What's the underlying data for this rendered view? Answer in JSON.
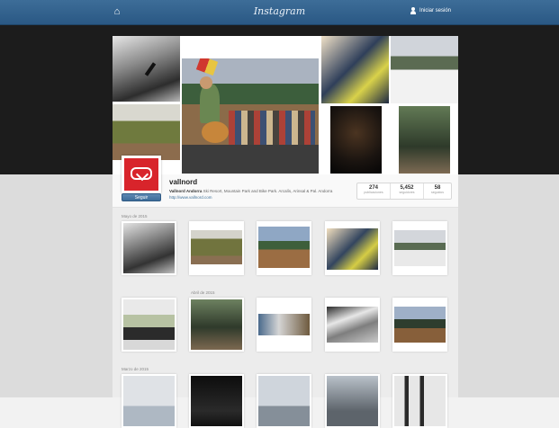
{
  "topbar": {
    "home_icon": "home-icon",
    "logo_text": "Instagram",
    "login_label": "Iniciar sesión",
    "user_icon": "user-icon"
  },
  "profile": {
    "username": "vallnord",
    "display_name": "Vallnord Andorra",
    "bio": "Ski Resort, Mountain Park and Bike Park. Arcalís, Arinsal & Pal. Andorra",
    "website": "http://www.vallnord.com",
    "follow_label": "Seguir",
    "stats": [
      {
        "value": "274",
        "label": "publicaciones"
      },
      {
        "value": "5,452",
        "label": "seguidores"
      },
      {
        "value": "58",
        "label": "seguidos"
      }
    ]
  },
  "feed": {
    "months": [
      "Mayo de 2015",
      "Abril de 2015",
      "Marzo de 2015"
    ]
  }
}
